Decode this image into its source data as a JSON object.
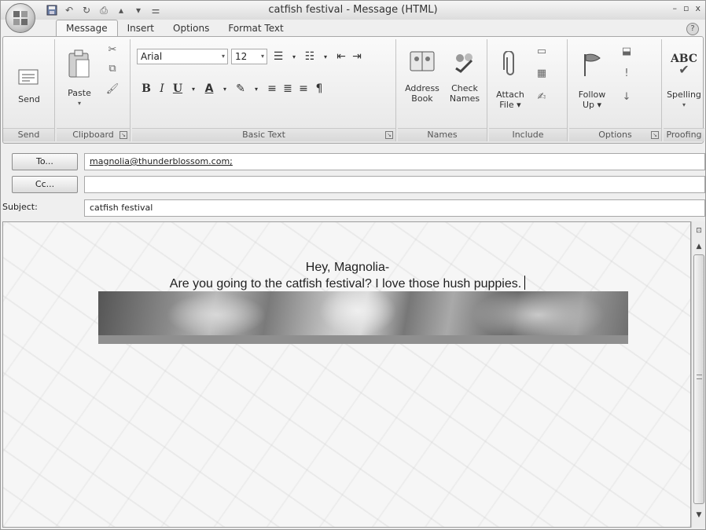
{
  "window": {
    "title": "catfish festival - Message (HTML)",
    "controls": [
      "–",
      "▫",
      "x"
    ]
  },
  "tabs": [
    "Message",
    "Insert",
    "Options",
    "Format Text"
  ],
  "ribbon": {
    "send": {
      "button": "Send",
      "group": "Send"
    },
    "clipboard": {
      "paste": "Paste",
      "group": "Clipboard"
    },
    "basic_text": {
      "font": "Arial",
      "size": "12",
      "group": "Basic Text",
      "bold": "B",
      "italic": "I",
      "underline": "U",
      "font_color": "A"
    },
    "names": {
      "address_book_1": "Address",
      "address_book_2": "Book",
      "check_names_1": "Check",
      "check_names_2": "Names",
      "group": "Names"
    },
    "include": {
      "attach_1": "Attach",
      "attach_2": "File ▾",
      "group": "Include"
    },
    "options": {
      "follow_1": "Follow",
      "follow_2": "Up ▾",
      "group": "Options"
    },
    "proofing": {
      "spelling_icon": "ABC",
      "spelling": "Spelling",
      "group": "Proofing"
    }
  },
  "header": {
    "to_button": "To...",
    "cc_button": "Cc...",
    "subject_label": "Subject:",
    "to_value": "magnolia@thunderblossom.com;",
    "cc_value": "",
    "subject_value": "catfish festival"
  },
  "body": {
    "line1": "Hey, Magnolia-",
    "line2": "Are you going to the catfish festival? I love those hush puppies."
  },
  "colors": {
    "ribbon_bg": "#f2f2f2",
    "accent": "#9c9c9c"
  }
}
